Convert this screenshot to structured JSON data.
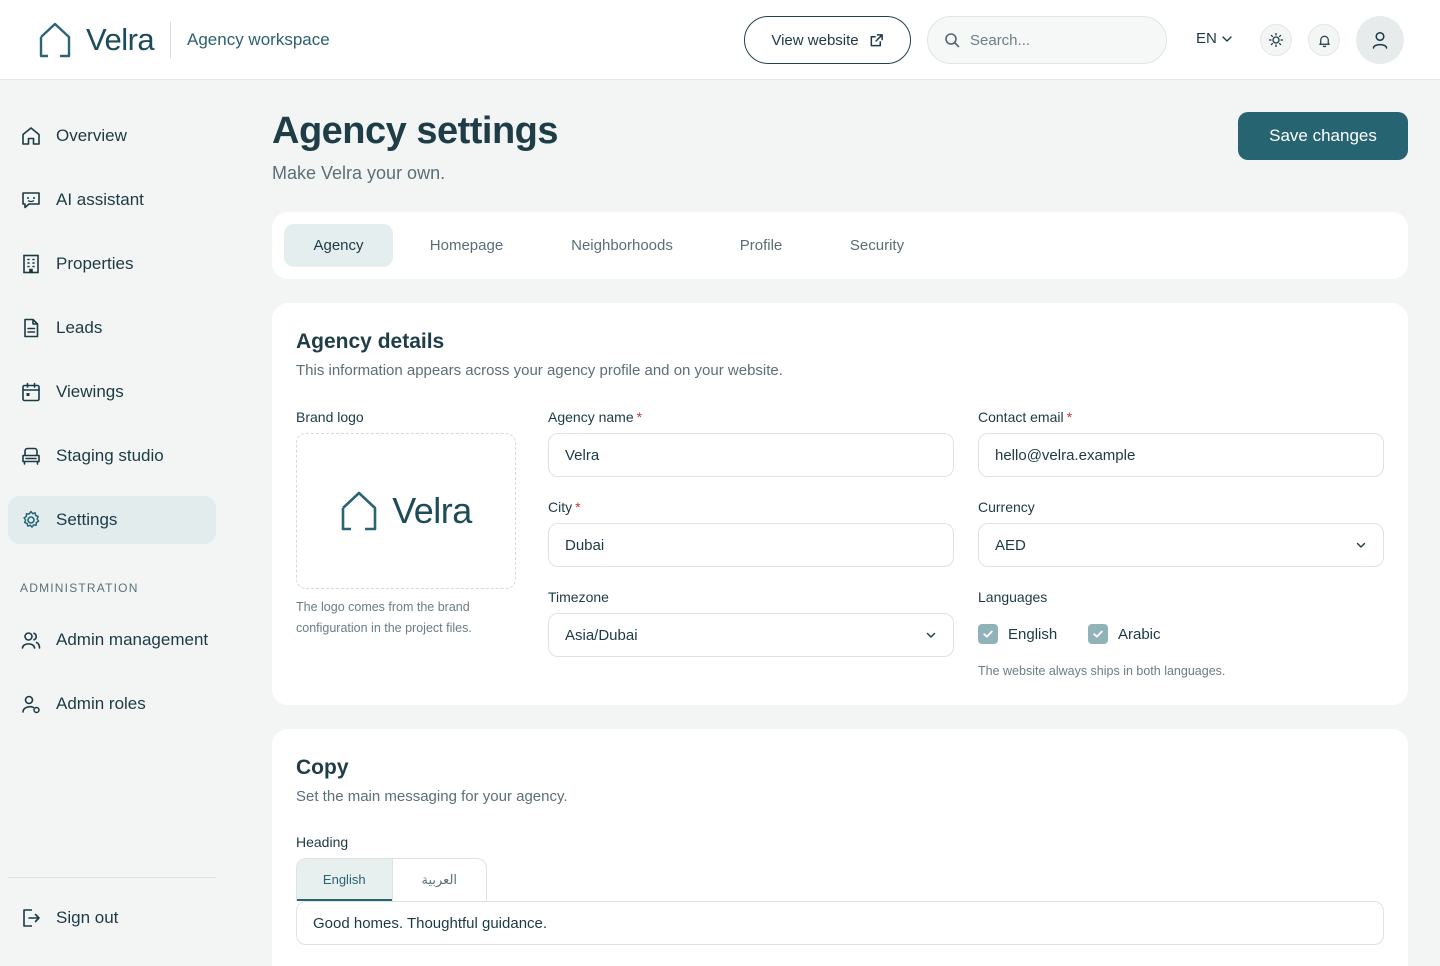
{
  "header": {
    "brand": "Velra",
    "workspace": "Agency workspace",
    "view_website": "View website",
    "search_placeholder": "Search...",
    "language": "EN"
  },
  "sidebar": {
    "items": [
      {
        "label": "Overview",
        "icon": "home-icon"
      },
      {
        "label": "AI assistant",
        "icon": "chat-bot-icon"
      },
      {
        "label": "Properties",
        "icon": "building-icon"
      },
      {
        "label": "Leads",
        "icon": "document-icon"
      },
      {
        "label": "Viewings",
        "icon": "calendar-icon"
      },
      {
        "label": "Staging studio",
        "icon": "sofa-icon"
      },
      {
        "label": "Settings",
        "icon": "gear-icon",
        "active": true
      }
    ],
    "section": "ADMINISTRATION",
    "admin_items": [
      {
        "label": "Admin management",
        "icon": "users-icon"
      },
      {
        "label": "Admin roles",
        "icon": "user-role-icon"
      }
    ],
    "sign_out": "Sign out"
  },
  "page": {
    "title": "Agency settings",
    "subtitle": "Make Velra your own.",
    "save": "Save changes"
  },
  "tabs": [
    "Agency",
    "Homepage",
    "Neighborhoods",
    "Profile",
    "Security"
  ],
  "active_tab": "Agency",
  "agency_details": {
    "title": "Agency details",
    "subtitle": "This information appears across your agency profile and on your website.",
    "brand_logo_label": "Brand logo",
    "logo_text": "Velra",
    "logo_hint": "The logo comes from the brand configuration in the project files.",
    "agency_name_label": "Agency name",
    "agency_name": "Velra",
    "contact_email_label": "Contact email",
    "contact_email": "hello@velra.example",
    "city_label": "City",
    "city": "Dubai",
    "currency_label": "Currency",
    "currency": "AED",
    "timezone_label": "Timezone",
    "timezone": "Asia/Dubai",
    "languages_label": "Languages",
    "languages": [
      {
        "label": "English",
        "checked": true
      },
      {
        "label": "Arabic",
        "checked": true
      }
    ],
    "languages_hint": "The website always ships in both languages.",
    "required_mark": "*"
  },
  "copy": {
    "title": "Copy",
    "subtitle": "Set the main messaging for your agency.",
    "heading_label": "Heading",
    "lang_tabs": [
      "English",
      "العربية"
    ],
    "heading_value": "Good homes. Thoughtful guidance."
  },
  "colors": {
    "accent": "#276471",
    "sidebar_active": "#e2ecec",
    "required": "#c43a3a",
    "checkbox": "#8fb3b8"
  }
}
